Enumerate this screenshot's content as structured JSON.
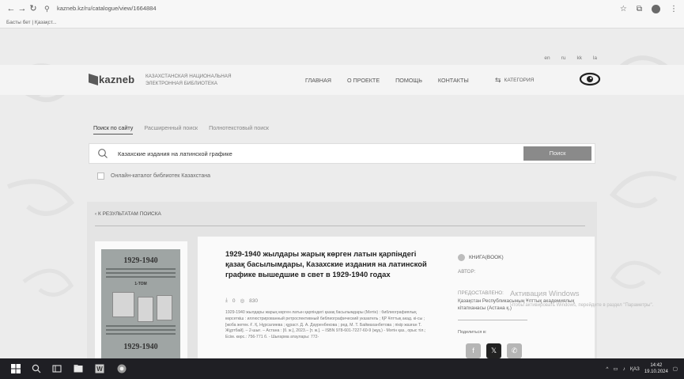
{
  "browser": {
    "url": "kazneb.kz/ru/catalogue/view/1664884",
    "bookmark": "Басты бет | Қазақст..."
  },
  "site": {
    "languages": [
      "en",
      "ru",
      "kk",
      "la"
    ],
    "logo": "kazneb",
    "library_name_line1": "КАЗАХСТАНСКАЯ НАЦИОНАЛЬНАЯ",
    "library_name_line2": "ЭЛЕКТРОННАЯ БИБЛИОТЕКА",
    "nav": [
      "ГЛАВНАЯ",
      "О ПРОЕКТЕ",
      "ПОМОЩЬ",
      "КОНТАКТЫ"
    ],
    "categories_label": "КАТЕГОРИЯ"
  },
  "search": {
    "tabs": [
      "Поиск по сайту",
      "Расширенный поиск",
      "Полнотекстовый поиск"
    ],
    "query": "Казахские издания на латинской графике",
    "button": "Поиск",
    "checkbox_label": "Онлайн-каталог библиотек Казахстана"
  },
  "results": {
    "back_label": "К РЕЗУЛЬТАТАМ ПОИСКА"
  },
  "book": {
    "cover": {
      "year_range": "1929-1940",
      "volume": "1-ТОМ"
    },
    "title": "1929-1940 жылдары жарық көрген латын қарпіндегі қазақ басылымдары, Казахские издания на латинской графике вышедшие в свет в 1929-1940 годах",
    "downloads": "0",
    "views": "830",
    "description": "1929-1940 жылдары жарық көрген латын қарпіндегі қазақ басылымдары (Мәтін) : библиографиялық көрсеткіш : иллюстрированный ретроспективный библиографический указатель ; ҚР Ұлттық акад. кі-сы ; [жоба жетек. Ғ. Қ. Нұрсалиева ; құраст. Д. А. Дауренбекова ; ред. М. Т. Баймаханбетова ; пікір жазған Т. Жұртбай]. – 2-шығ. – Астана : [б. ж.], 2023.– [т. ж.]. – ISBN 978-601-7227-60-9 (жұқ.) - Мәтін қаз., орыс тіл.; Есім. көрс.: 756-771 б. - Шығарма атаулары: 772-",
    "type": "КНИГА(BOOK)",
    "author_label": "АВТОР:",
    "provided_label": "ПРЕДОСТАВЛЕНО:",
    "provider": "Қазақстан Республикасының Ұлттық академиялық кітапханасы (Астана қ.)",
    "share_label": "Поделиться в:"
  },
  "activation": {
    "title": "Активация Windows",
    "subtitle": "Чтобы активировать Windows, перейдите в раздел \"Параметры\"."
  },
  "taskbar": {
    "lang": "ҚАЗ",
    "time": "14:42",
    "date": "19.10.2024"
  }
}
